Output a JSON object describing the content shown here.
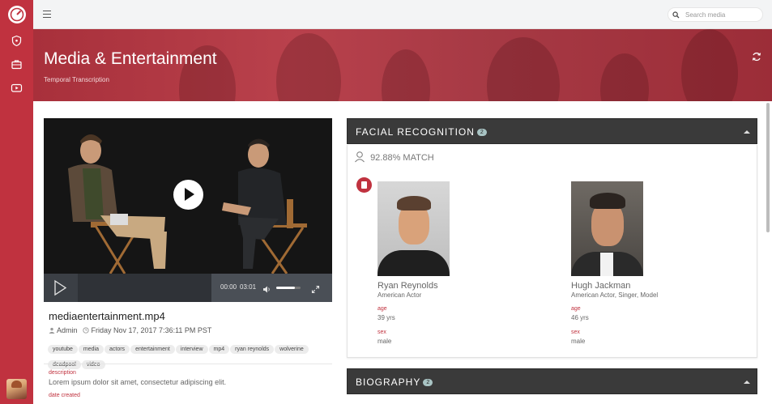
{
  "topbar": {
    "search_placeholder": "Search media"
  },
  "banner": {
    "title": "Media & Entertainment",
    "subtitle": "Temporal Transcription"
  },
  "player": {
    "current_time": "00:00",
    "duration": "03:01",
    "volume": 0.75
  },
  "media": {
    "file_name": "mediaentertainment.mp4",
    "owner": "Admin",
    "uploaded": "Friday Nov 17, 2017 7:36:11 PM PST",
    "tags": [
      "youtube",
      "media",
      "actors",
      "entertainment",
      "interview",
      "mp4",
      "ryan reynolds",
      "wolverine",
      "deadpool",
      "video"
    ],
    "description_label": "description",
    "description": "Lorem ipsum dolor sit amet, consectetur adipiscing elit.",
    "date_created_label": "date created"
  },
  "facial": {
    "title": "FACIAL RECOGNITION",
    "count": "2",
    "match": "92.88% MATCH",
    "people": [
      {
        "name": "Ryan Reynolds",
        "role": "American Actor",
        "age_label": "age",
        "age": "39 yrs",
        "sex_label": "sex",
        "sex": "male"
      },
      {
        "name": "Hugh Jackman",
        "role": "American Actor, Singer, Model",
        "age_label": "age",
        "age": "46 yrs",
        "sex_label": "sex",
        "sex": "male"
      }
    ]
  },
  "biography": {
    "title": "BIOGRAPHY",
    "count": "2"
  },
  "colors": {
    "brand": "#c0323f",
    "panel_header": "#3a3a3a",
    "badge": "#a9c4c4"
  },
  "icons": {
    "logo": "gauge-logo-icon",
    "sidebar": [
      "shield-icon",
      "briefcase-icon",
      "video-icon"
    ],
    "menu": "hamburger-menu-icon",
    "search": "search-icon",
    "refresh": "refresh-icon"
  }
}
